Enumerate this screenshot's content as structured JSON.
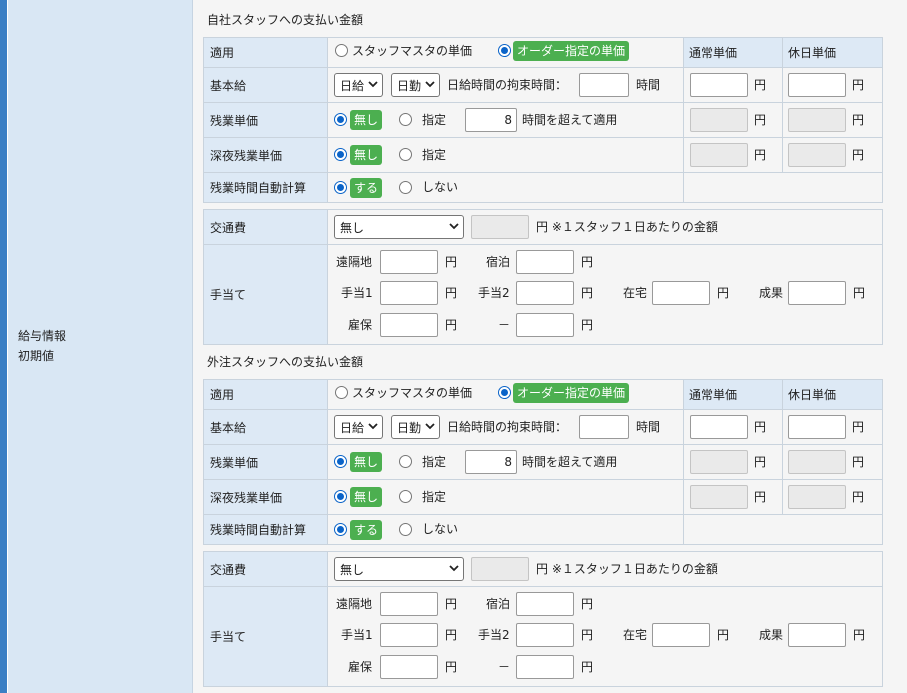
{
  "side_label": {
    "line1": "給与情報",
    "line2": "初期値"
  },
  "sections": [
    {
      "title": "自社スタッフへの支払い金額",
      "apply_label": "適用",
      "apply_opt1": "スタッフマスタの単価",
      "apply_opt2": "オーダー指定の単価",
      "col_normal": "通常単価",
      "col_holiday": "休日単価",
      "base_label": "基本給",
      "base_select1": "日給",
      "base_select2": "日勤",
      "binding_label": "日給時間の拘束時間：",
      "binding_value": "",
      "hours_unit": "時間",
      "yen": "円",
      "overtime_label": "残業単価",
      "none_badge": "無し",
      "specify": "指定",
      "overtime_hours": "8",
      "overtime_suffix": "時間を超えて適用",
      "night_label": "深夜残業単価",
      "auto_label": "残業時間自動計算",
      "do_badge": "する",
      "dont": "しない",
      "transport_label": "交通費",
      "transport_select": "無し",
      "transport_note": "円 ※１スタッフ１日あたりの金額",
      "allowance_label": "手当て",
      "a_remote": "遠隔地",
      "a_lodging": "宿泊",
      "a_allow1": "手当1",
      "a_allow2": "手当2",
      "a_home": "在宅",
      "a_result": "成果",
      "a_employ": "雇保",
      "a_dash": "－"
    },
    {
      "title": "外注スタッフへの支払い金額",
      "apply_label": "適用",
      "apply_opt1": "スタッフマスタの単価",
      "apply_opt2": "オーダー指定の単価",
      "col_normal": "通常単価",
      "col_holiday": "休日単価",
      "base_label": "基本給",
      "base_select1": "日給",
      "base_select2": "日勤",
      "binding_label": "日給時間の拘束時間：",
      "binding_value": "",
      "hours_unit": "時間",
      "yen": "円",
      "overtime_label": "残業単価",
      "none_badge": "無し",
      "specify": "指定",
      "overtime_hours": "8",
      "overtime_suffix": "時間を超えて適用",
      "night_label": "深夜残業単価",
      "auto_label": "残業時間自動計算",
      "do_badge": "する",
      "dont": "しない",
      "transport_label": "交通費",
      "transport_select": "無し",
      "transport_note": "円 ※１スタッフ１日あたりの金額",
      "allowance_label": "手当て",
      "a_remote": "遠隔地",
      "a_lodging": "宿泊",
      "a_allow1": "手当1",
      "a_allow2": "手当2",
      "a_home": "在宅",
      "a_result": "成果",
      "a_employ": "雇保",
      "a_dash": "－"
    }
  ]
}
